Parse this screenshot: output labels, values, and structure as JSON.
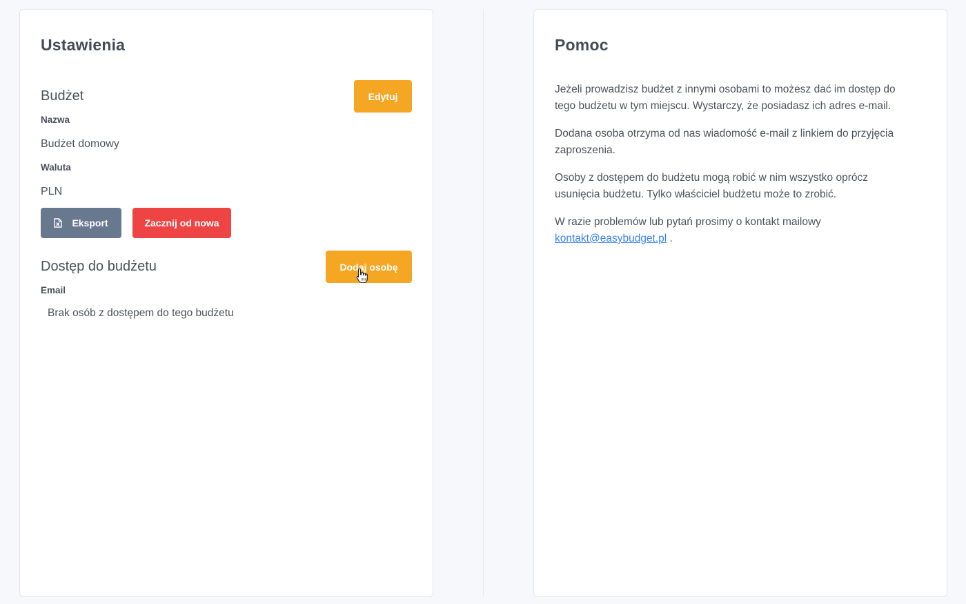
{
  "settings": {
    "title": "Ustawienia",
    "budget": {
      "heading": "Budżet",
      "edit_label": "Edytuj",
      "name_label": "Nazwa",
      "name_value": "Budżet domowy",
      "currency_label": "Waluta",
      "currency_value": "PLN",
      "export_label": "Eksport",
      "export_icon": "excel-file-icon",
      "reset_label": "Zacznij od nowa"
    },
    "access": {
      "heading": "Dostęp do budżetu",
      "add_label": "Dodaj osobę",
      "email_label": "Email",
      "empty_text": "Brak osób z dostępem do tego budżetu"
    }
  },
  "help": {
    "title": "Pomoc",
    "paragraphs": [
      "Jeżeli prowadzisz budżet z innymi osobami to możesz dać im dostęp do tego budżetu w tym miejscu. Wystarczy, że posiadasz ich adres e-mail.",
      "Dodana osoba otrzyma od nas wiadomość e-mail z linkiem do przyjęcia zaproszenia.",
      "Osoby z dostępem do budżetu mogą robić w nim wszystko oprócz usunięcia budżetu. Tylko właściciel budżetu może to zrobić."
    ],
    "contact_text": "W razie problemów lub pytań prosimy o kontakt mailowy",
    "contact_email": "kontakt@easybudget.pl",
    "contact_suffix": "."
  },
  "colors": {
    "accent": "#f5a623",
    "danger": "#ef4444",
    "secondary": "#67788f",
    "link": "#3b82f6"
  }
}
